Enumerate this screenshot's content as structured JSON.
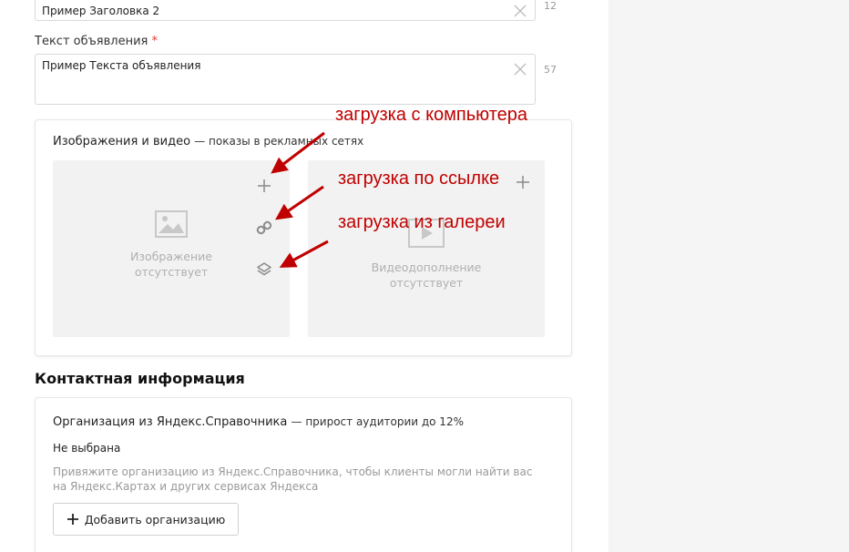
{
  "headline2": {
    "value": "Пример Заголовка 2",
    "counter": "12"
  },
  "ad_text": {
    "label": "Текст объявления",
    "required_mark": "*",
    "value": "Пример Текста объявления",
    "counter": "57"
  },
  "media": {
    "title": "Изображения и видео",
    "subtitle": "— показы в рекламных сетях",
    "image_placeholder": [
      "Изображение",
      "отсутствует"
    ],
    "video_placeholder": [
      "Видеодополнение",
      "отсутствует"
    ]
  },
  "annotations": {
    "upload_computer": "загрузка с компьютера",
    "upload_link": "загрузка по ссылке",
    "upload_gallery": "загрузка из галереи"
  },
  "contacts": {
    "section_title": "Контактная информация",
    "org_title": "Организация из Яндекс.Справочника",
    "org_subtitle": "— прирост аудитории до 12%",
    "org_status": "Не выбрана",
    "org_hint": "Привяжите организацию из Яндекс.Справочника, чтобы клиенты могли найти вас на Яндекс.Картах и других сервисах Яндекса",
    "add_org_button": "Добавить организацию"
  },
  "colors": {
    "annotation": "#c00000",
    "required": "#e53935",
    "placeholder_bg": "#f2f2f2"
  }
}
